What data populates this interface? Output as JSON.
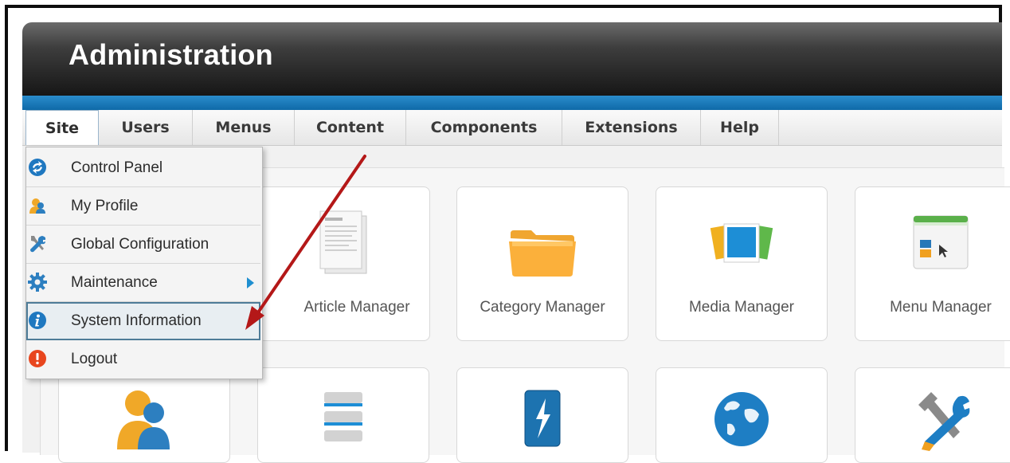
{
  "header": {
    "title": "Administration"
  },
  "menubar": {
    "items": [
      {
        "label": "Site",
        "active": true
      },
      {
        "label": "Users"
      },
      {
        "label": "Menus"
      },
      {
        "label": "Content"
      },
      {
        "label": "Components"
      },
      {
        "label": "Extensions"
      },
      {
        "label": "Help"
      }
    ]
  },
  "site_menu": {
    "items": [
      {
        "label": "Control Panel",
        "icon": "control-panel-icon"
      },
      {
        "label": "My Profile",
        "icon": "profile-icon"
      },
      {
        "label": "Global Configuration",
        "icon": "tools-icon"
      },
      {
        "label": "Maintenance",
        "icon": "gear-icon",
        "has_submenu": true
      },
      {
        "label": "System Information",
        "icon": "info-icon",
        "highlighted": true
      },
      {
        "label": "Logout",
        "icon": "logout-icon"
      }
    ]
  },
  "cards": [
    {
      "label": "Article Manager",
      "icon": "article-icon"
    },
    {
      "label": "Category Manager",
      "icon": "folder-icon"
    },
    {
      "label": "Media Manager",
      "icon": "media-icon"
    },
    {
      "label": "Menu Manager",
      "icon": "menu-manager-icon"
    }
  ],
  "cards_row2": [
    {
      "icon": "users-icon"
    },
    {
      "icon": "modules-icon"
    },
    {
      "icon": "plugin-icon"
    },
    {
      "icon": "globe-icon"
    },
    {
      "icon": "wrench-icon"
    }
  ],
  "colors": {
    "accent_blue": "#1a7dc0",
    "arrow_red": "#b41818",
    "header_dark": "#161616"
  }
}
